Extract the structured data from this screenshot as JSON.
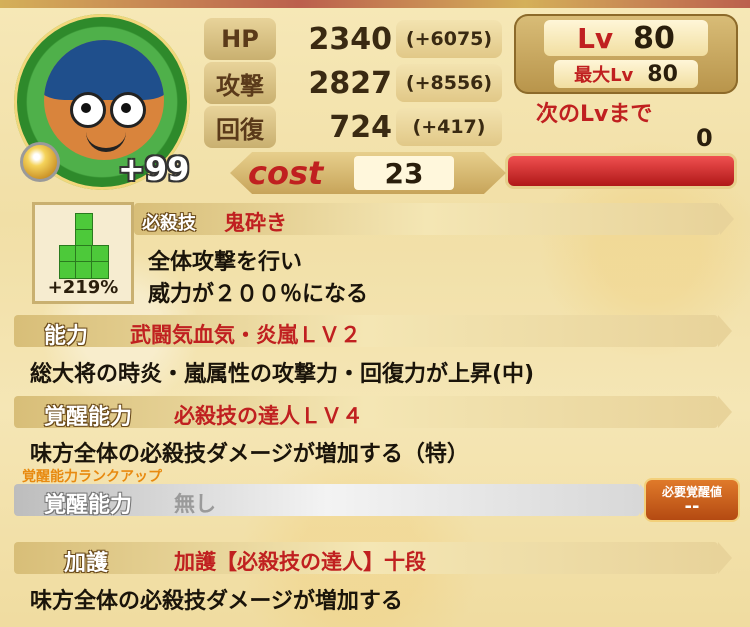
{
  "unit": {
    "plus_level": "+99"
  },
  "stats": {
    "hp": {
      "label": "HP",
      "value": "2340",
      "bonus": "(+6075)"
    },
    "attack": {
      "label": "攻撃",
      "value": "2827",
      "bonus": "(+8556)"
    },
    "recovery": {
      "label": "回復",
      "value": "724",
      "bonus": "(+417)"
    }
  },
  "level": {
    "label": "Lv",
    "value": "80",
    "max_label": "最大Lv",
    "max_value": "80",
    "next_label": "次のLvまで",
    "next_value": "0",
    "exp_fill": 1.0
  },
  "cost": {
    "label": "cost",
    "value": "23"
  },
  "skill": {
    "pct": "+219%",
    "label": "必殺技",
    "name": "鬼砕き",
    "desc_line1": "全体攻撃を行い",
    "desc_line2": "威力が２００％になる"
  },
  "ability": {
    "label": "能力",
    "name": "武闘気血気・炎嵐ＬＶ２",
    "desc": "総大将の時炎・嵐属性の攻撃力・回復力が上昇(中)"
  },
  "awakening": {
    "label": "覚醒能力",
    "name": "必殺技の達人ＬＶ４",
    "desc": "味方全体の必殺技ダメージが増加する（特）"
  },
  "awakening_rank_up": {
    "title": "覚醒能力ランクアップ",
    "label": "覚醒能力",
    "name": "無し",
    "req_label": "必要覚醒値",
    "req_value": "--"
  },
  "blessing": {
    "label": "加護",
    "name": "加護【必殺技の達人】十段",
    "desc": "味方全体の必殺技ダメージが増加する"
  },
  "colors": {
    "accent_red": "#c02020",
    "panel_gold": "#e8d39a",
    "exp_bar": "#e03030",
    "rank_orange": "#e88a10"
  }
}
